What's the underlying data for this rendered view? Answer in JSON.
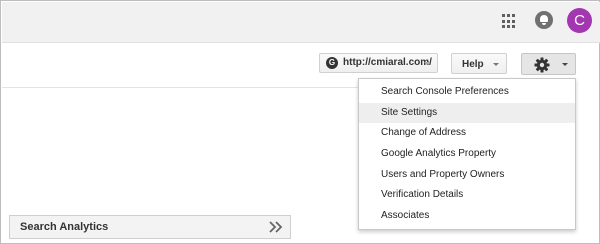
{
  "header": {
    "apps_icon": "apps-grid-icon",
    "notifications_icon": "bell-icon",
    "avatar_letter": "C",
    "avatar_color": "#a337b0"
  },
  "toolbar": {
    "site_selector": {
      "icon_letter": "G",
      "value": "http://cmiaral.com/"
    },
    "help_label": "Help",
    "settings_icon": "gear-icon"
  },
  "settings_menu": {
    "items": [
      {
        "label": "Search Console Preferences",
        "active": false
      },
      {
        "label": "Site Settings",
        "active": true
      },
      {
        "label": "Change of Address",
        "active": false
      },
      {
        "label": "Google Analytics Property",
        "active": false
      },
      {
        "label": "Users and Property Owners",
        "active": false
      },
      {
        "label": "Verification Details",
        "active": false
      },
      {
        "label": "Associates",
        "active": false
      }
    ]
  },
  "side_panel": {
    "title": "Search Analytics",
    "expand_icon": "double-chevron-right-icon"
  }
}
